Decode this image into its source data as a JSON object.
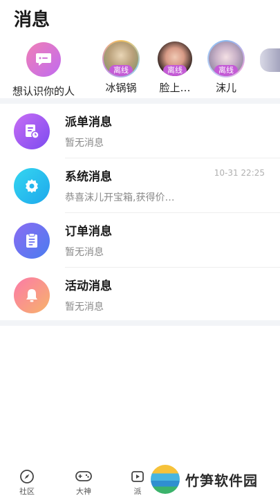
{
  "header": {
    "title": "消息"
  },
  "contacts": {
    "meet_label": "想认识你的人",
    "people": [
      {
        "name": "冰锅锅",
        "status": "离线"
      },
      {
        "name": "脸上…",
        "status": "离线"
      },
      {
        "name": "沫儿",
        "status": "离线"
      }
    ]
  },
  "messages": [
    {
      "title": "派单消息",
      "subtitle": "暂无消息",
      "time": ""
    },
    {
      "title": "系统消息",
      "subtitle": "恭喜沫儿开宝箱,获得价…",
      "time": "10-31 22:25"
    },
    {
      "title": "订单消息",
      "subtitle": "暂无消息",
      "time": ""
    },
    {
      "title": "活动消息",
      "subtitle": "暂无消息",
      "time": ""
    }
  ],
  "tabbar": {
    "community": "社区",
    "master": "大神",
    "dispatch": "派"
  },
  "watermark": {
    "text": "竹笋软件园"
  }
}
